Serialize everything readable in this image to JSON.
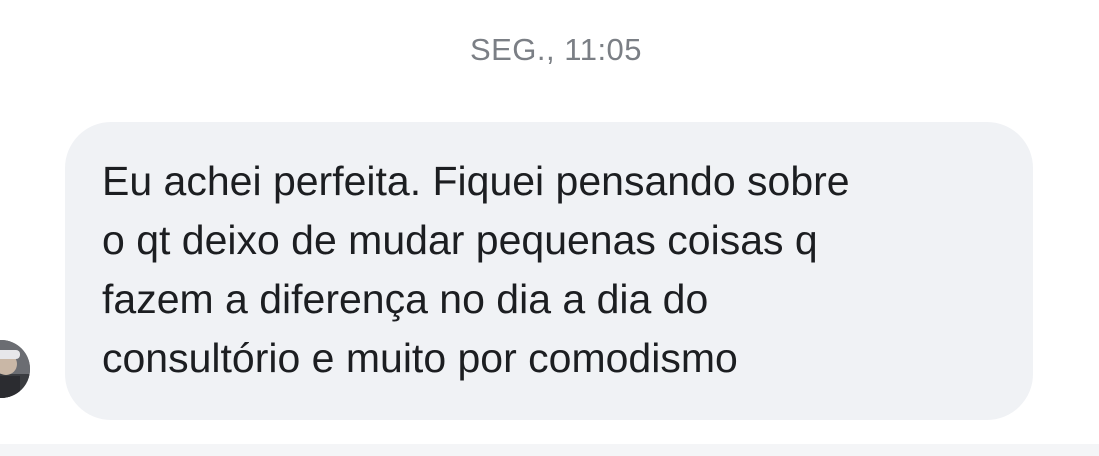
{
  "conversation": {
    "timestamp": "SEG., 11:05",
    "message": {
      "text": "Eu achei perfeita. Fiquei pensando sobre\no qt deixo de mudar pequenas coisas q\nfazem a diferença no dia a dia do\nconsultório e muito por comodismo",
      "direction": "incoming"
    },
    "avatar": {
      "icon": "contact-avatar"
    }
  },
  "colors": {
    "bubble": "#f0f2f5",
    "message_text": "#1c1e21",
    "timestamp_text": "#7b7f85",
    "background": "#ffffff"
  }
}
